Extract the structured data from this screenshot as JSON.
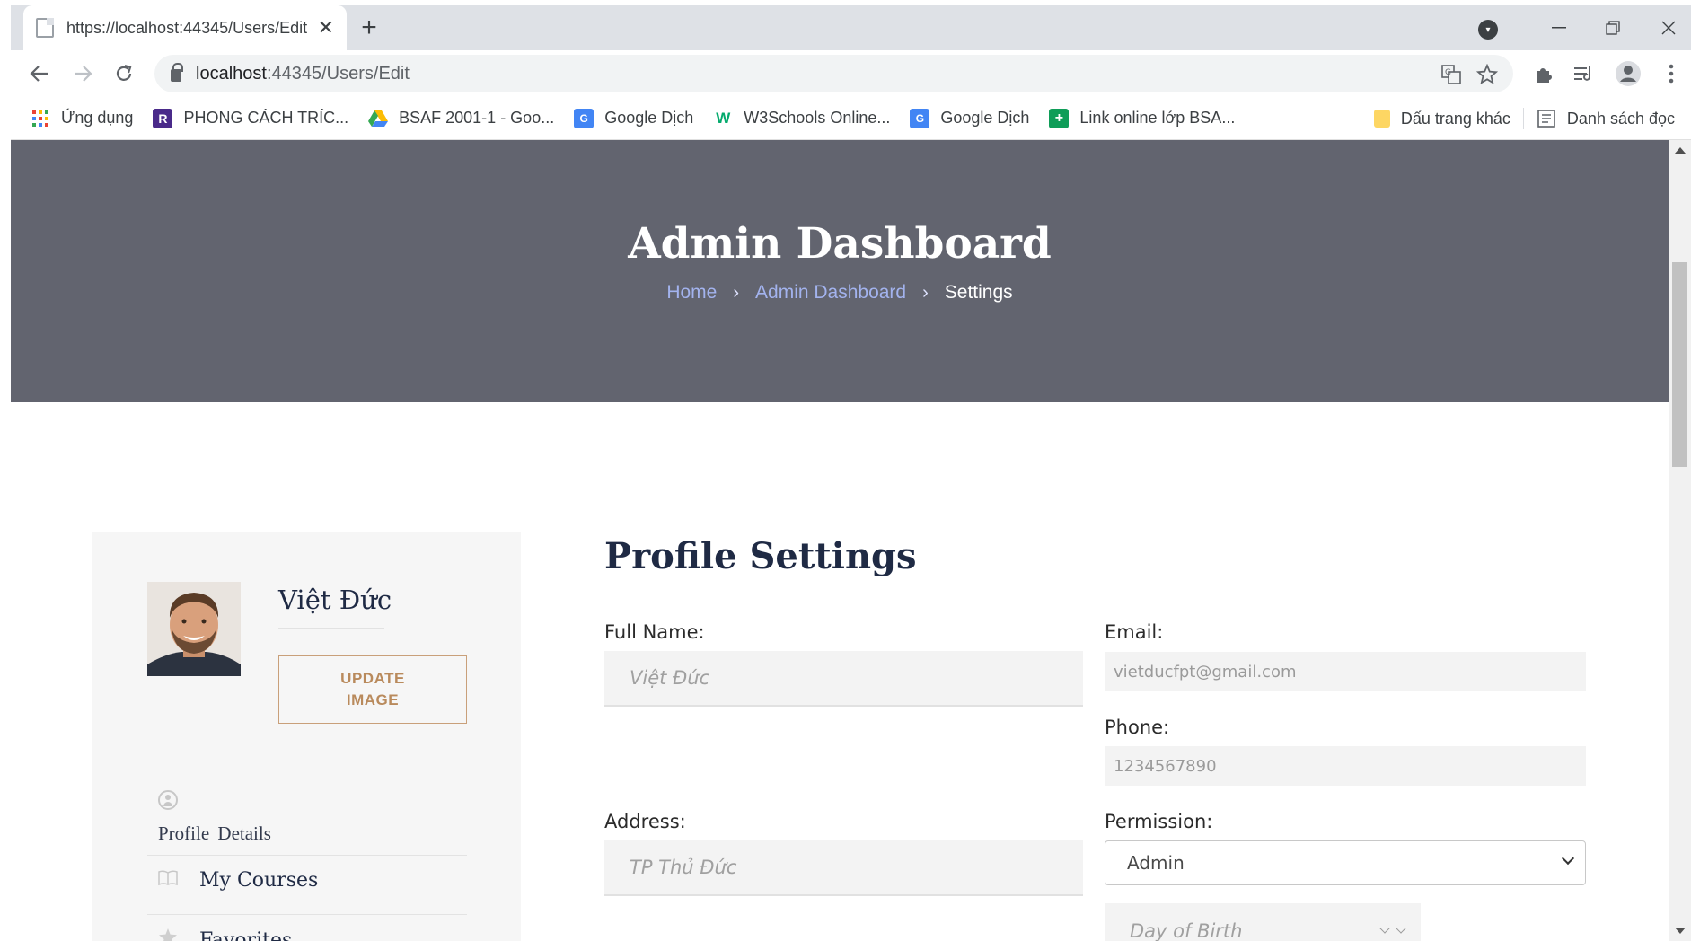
{
  "browser": {
    "tab_title": "https://localhost:44345/Users/Edit",
    "tab_close": "✕",
    "new_tab": "+",
    "url_host": "localhost",
    "url_rest": ":44345/Users/Edit"
  },
  "bookmarks": {
    "items": [
      {
        "label": "Ứng dụng",
        "icon": "apps-grid-icon"
      },
      {
        "label": "PHONG CÁCH TRÍC...",
        "icon": "r-logo-icon"
      },
      {
        "label": "BSAF 2001-1 - Goo...",
        "icon": "google-drive-icon"
      },
      {
        "label": "Google Dịch",
        "icon": "google-translate-icon"
      },
      {
        "label": "W3Schools Online...",
        "icon": "w3schools-icon"
      },
      {
        "label": "Google Dịch",
        "icon": "google-translate-icon"
      },
      {
        "label": "Link online lớp BSA...",
        "icon": "google-sheets-icon"
      }
    ],
    "other": "Dấu trang khác",
    "reading_list": "Danh sách đọc"
  },
  "hero": {
    "title": "Admin Dashboard",
    "breadcrumb": {
      "home": "Home",
      "sep": "›",
      "parent": "Admin Dashboard",
      "current": "Settings"
    }
  },
  "sidebar": {
    "user_name": "Việt Đức",
    "update_image_line1": "UPDATE",
    "update_image_line2": "IMAGE",
    "items": {
      "profile": "Profile  Details",
      "courses": "My Courses",
      "favorites": "Favorites"
    }
  },
  "form": {
    "title": "Profile Settings",
    "full_name_label": "Full Name:",
    "full_name_placeholder": "Việt Đức",
    "email_label": "Email:",
    "email_value": "vietducfpt@gmail.com",
    "phone_label": "Phone:",
    "phone_value": "1234567890",
    "address_label": "Address:",
    "address_placeholder": "TP Thủ Đức",
    "permission_label": "Permission:",
    "permission_value": "Admin",
    "dob_placeholder": "Day of Birth"
  },
  "colors": {
    "hero_bg": "#62646f",
    "breadcrumb_link": "#a3b3ee",
    "accent_gold": "#b98a5c",
    "heading_navy": "#1f2a44"
  }
}
